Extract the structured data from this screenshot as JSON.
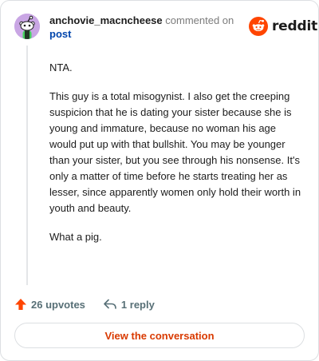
{
  "header": {
    "username": "anchovie_macncheese",
    "action_text": "commented on",
    "target_link": "post",
    "brand": "reddit"
  },
  "comment": {
    "paragraphs": [
      "NTA.",
      "This guy is a total misogynist. I also get the creeping suspicion that he is dating your sister because she is young and immature, because no woman his age would put up with that bullshit. You may be younger than your sister, but you see through his nonsense. It's only a matter of time before he starts treating her as lesser, since apparently women only hold their worth in youth and beauty.",
      "What a pig."
    ]
  },
  "footer": {
    "upvotes_label": "26 upvotes",
    "reply_label": "1 reply"
  },
  "cta": {
    "label": "View the conversation"
  },
  "colors": {
    "brand_orange": "#ff4500",
    "link_blue": "#0045ac",
    "cta_text": "#d93a00",
    "avatar_bg": "#c9a6e4"
  },
  "icons": {
    "avatar": "snoo-avatar-icon",
    "logo": "reddit-logo-icon",
    "upvote": "upvote-arrow-icon",
    "reply": "reply-arrow-icon"
  }
}
